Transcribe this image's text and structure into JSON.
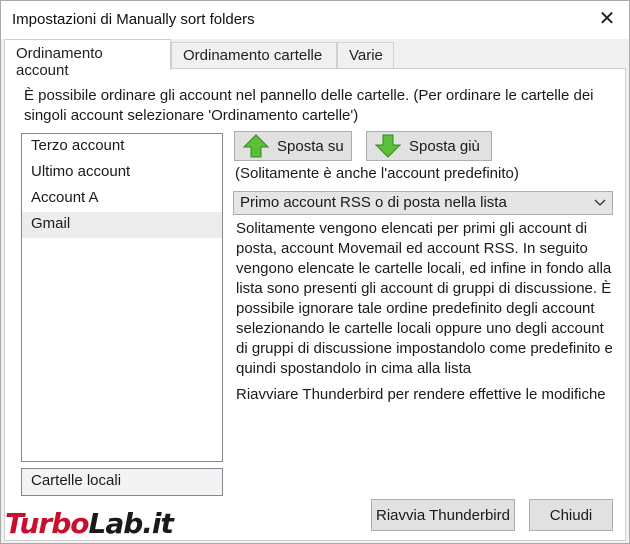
{
  "window": {
    "title": "Impostazioni di Manually sort folders",
    "close_icon": "close-icon"
  },
  "tabs": [
    {
      "label": "Ordinamento account",
      "active": true
    },
    {
      "label": "Ordinamento cartelle",
      "active": false
    },
    {
      "label": "Varie",
      "active": false
    }
  ],
  "intro_text": "È possibile ordinare gli account nel pannello delle cartelle. (Per ordinare le cartelle dei singoli account selezionare 'Ordinamento cartelle')",
  "accounts": [
    {
      "label": "Terzo account",
      "selected": false
    },
    {
      "label": "Ultimo account",
      "selected": false
    },
    {
      "label": "Account A",
      "selected": false
    },
    {
      "label": "Gmail",
      "selected": true
    }
  ],
  "local_folders_label": "Cartelle locali",
  "buttons": {
    "move_up": "Sposta su",
    "move_down": "Sposta giù",
    "restart": "Riavvia Thunderbird",
    "close": "Chiudi"
  },
  "hint_text": "(Solitamente è anche l'account predefinito)",
  "select": {
    "value": "Primo account RSS o di posta nella lista"
  },
  "description": "Solitamente vengono elencati per primi gli account di posta, account Movemail ed account RSS. In seguito vengono elencate le cartelle locali, ed infine in fondo alla lista sono presenti gli account di gruppi di discussione. È possibile ignorare tale ordine predefinito degli account selezionando le cartelle locali oppure uno degli account di gruppi di discussione impostandolo come predefinito e quindi spostandolo in cima alla lista",
  "restart_note": "Riavviare Thunderbird per rendere effettive le modifiche",
  "watermark": {
    "part1": "Turbo",
    "part2": "Lab.it"
  },
  "colors": {
    "arrow_green": "#5bbf3a",
    "watermark_red": "#c8102e"
  }
}
